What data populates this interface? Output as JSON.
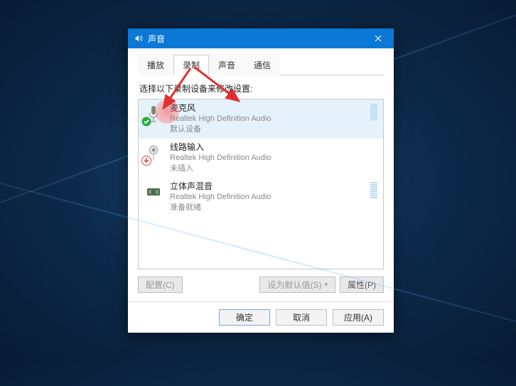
{
  "dialog": {
    "title": "声音",
    "tabs": {
      "playback": "播放",
      "recording": "录制",
      "sounds": "声音",
      "comm": "通信"
    },
    "instruction": "选择以下录制设备来修改设置:",
    "devices": [
      {
        "name": "麦克风",
        "driver": "Realtek High Definition Audio",
        "status": "默认设备",
        "selected": true,
        "badge": "check",
        "bars": true
      },
      {
        "name": "线路输入",
        "driver": "Realtek High Definition Audio",
        "status": "未插入",
        "selected": false,
        "badge": "down",
        "bars": false
      },
      {
        "name": "立体声混音",
        "driver": "Realtek High Definition Audio",
        "status": "准备就绪",
        "selected": false,
        "badge": null,
        "bars": true
      }
    ],
    "buttons": {
      "configure": "配置(C)",
      "set_default": "设为默认值(S)",
      "properties": "属性(P)",
      "ok": "确定",
      "cancel": "取消",
      "apply": "应用(A)"
    }
  }
}
